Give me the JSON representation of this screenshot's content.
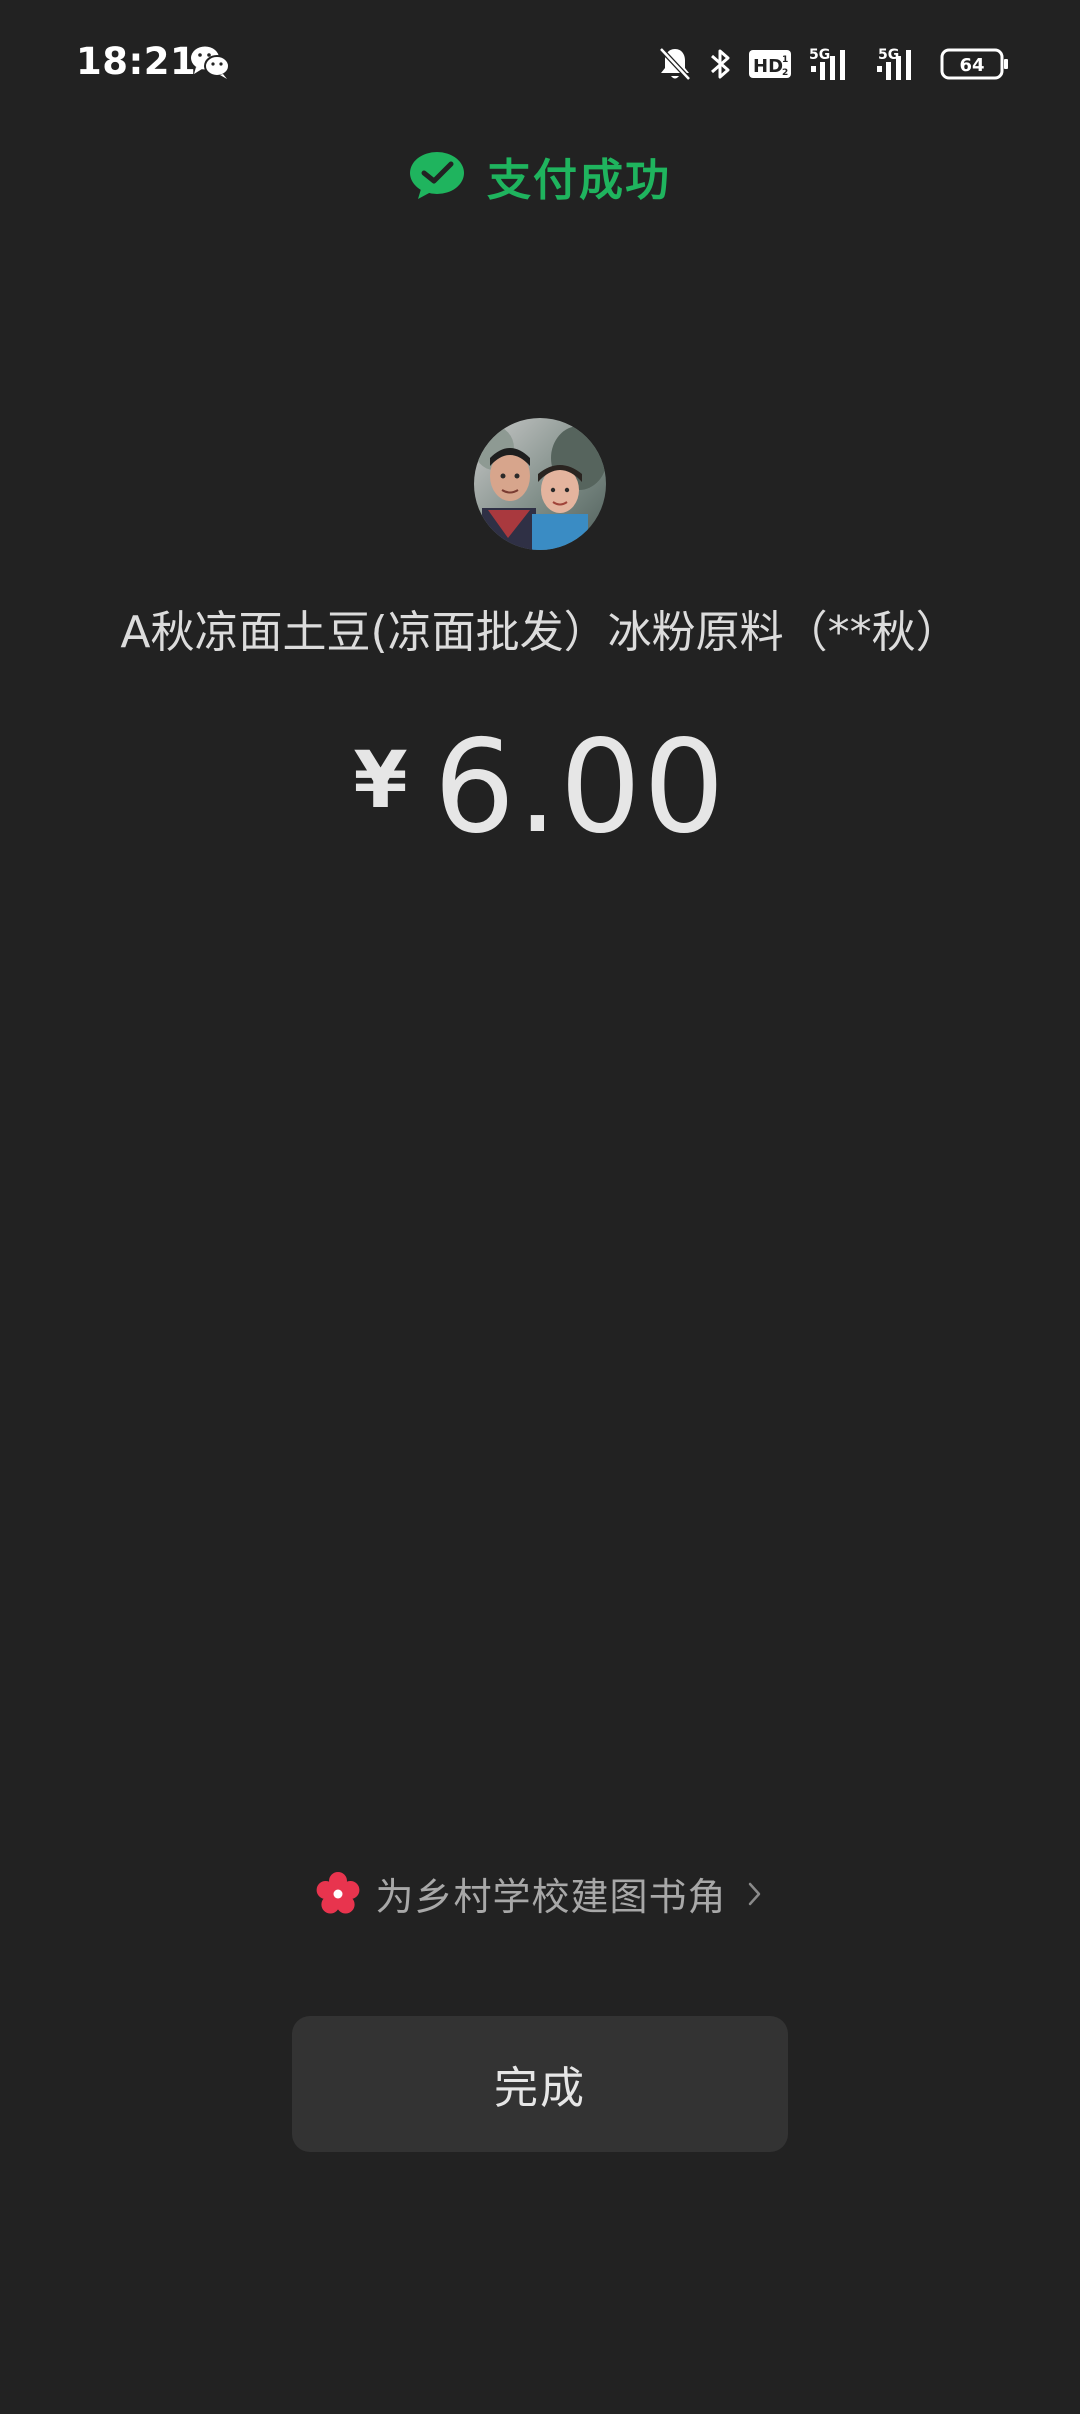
{
  "status_bar": {
    "time": "18:21",
    "hd_label": "HD",
    "signal1_label": "5G",
    "signal2_label": "5G",
    "battery_level": "64"
  },
  "payment": {
    "status_title": "支付成功",
    "merchant_name": "A秋凉面土豆(凉面批发）冰粉原料（**秋）",
    "currency_symbol": "¥",
    "amount": "6.00"
  },
  "promo": {
    "text": "为乡村学校建图书角"
  },
  "actions": {
    "done_label": "完成"
  },
  "colors": {
    "background": "#222222",
    "success_green": "#1fb45e",
    "button_bg": "#333333",
    "promo_red": "#e8344e"
  },
  "icons": {
    "status_app": "wechat-icon",
    "mute": "bell-off-icon",
    "bluetooth": "bluetooth-icon",
    "success": "wechat-pay-check-icon",
    "promo": "flower-icon",
    "chevron": "chevron-right-icon"
  }
}
